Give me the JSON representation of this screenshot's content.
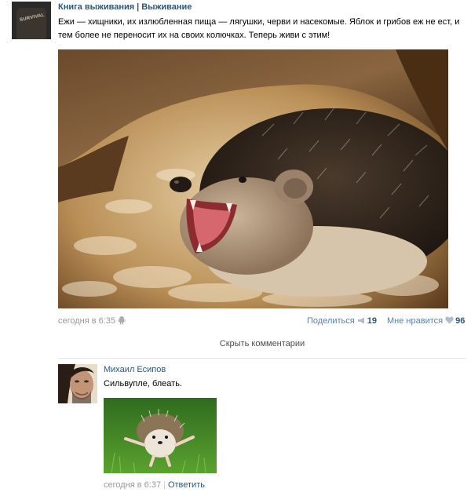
{
  "post": {
    "community": "Книга выживания",
    "separator": "|",
    "section": "Выживание",
    "avatar_text": "SURVIVAL",
    "text": "Ежи — хищники, их излюбленная пища — лягушки, черви и насекомые. Яблок и грибов еж не ест, и тем более не переносит их на своих колючках. Теперь живи с этим!",
    "time": "сегодня в 6:35",
    "share_label": "Поделиться",
    "share_count": "19",
    "like_label": "Мне нравится",
    "like_count": "96"
  },
  "comments_toggle": "Скрыть комментарии",
  "comment": {
    "author": "Михаил Есипов",
    "text": "Сильвупле, блеать.",
    "time": "сегодня в 6:37",
    "separator": "|",
    "reply_label": "Ответить"
  },
  "icons": [
    "android-icon",
    "megaphone-icon",
    "heart-icon"
  ],
  "colors": {
    "link": "#2b587a",
    "meta": "#999999",
    "action": "#5b7fa6"
  }
}
